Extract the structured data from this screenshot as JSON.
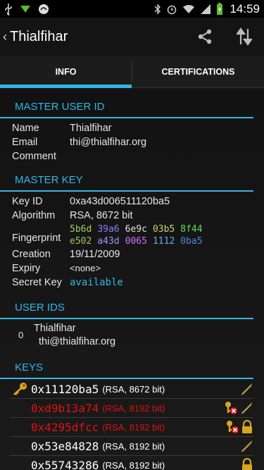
{
  "status_bar": {
    "time": "14:59"
  },
  "action_bar": {
    "back": "‹",
    "title": "Thialfihar"
  },
  "tabs": [
    {
      "label": "INFO"
    },
    {
      "label": "CERTIFICATIONS"
    }
  ],
  "master_user_id": {
    "header": "MASTER USER ID",
    "name_label": "Name",
    "name_value": "Thialfihar",
    "email_label": "Email",
    "email_value": "thi@thialfihar.org",
    "comment_label": "Comment",
    "comment_value": ""
  },
  "master_key": {
    "header": "MASTER KEY",
    "key_id_label": "Key ID",
    "key_id_value": "0xa43d006511120ba5",
    "algorithm_label": "Algorithm",
    "algorithm_value": "RSA, 8672 bit",
    "fingerprint_label": "Fingerprint",
    "fingerprint": [
      [
        {
          "text": "5b6d",
          "color": "#a0d060"
        },
        {
          "text": "39a6",
          "color": "#8a7dff"
        },
        {
          "text": "6e9c",
          "color": "#e0e0e0"
        },
        {
          "text": "03b5",
          "color": "#c8d46a"
        },
        {
          "text": "8f44",
          "color": "#5fdc5f"
        }
      ],
      [
        {
          "text": "e502",
          "color": "#9ac860"
        },
        {
          "text": "a43d",
          "color": "#a88cff"
        },
        {
          "text": "0065",
          "color": "#d86cff"
        },
        {
          "text": "1112",
          "color": "#6aa8f0"
        },
        {
          "text": "0ba5",
          "color": "#4f86e0"
        }
      ]
    ],
    "creation_label": "Creation",
    "creation_value": "19/11/2009",
    "expiry_label": "Expiry",
    "expiry_value": "<none>",
    "secret_key_label": "Secret Key",
    "secret_key_value": "available"
  },
  "user_ids": {
    "header": "USER IDS",
    "items": [
      {
        "rank": "0",
        "name": "Thialfihar",
        "email": "thi@thialfihar.org"
      }
    ]
  },
  "keys": {
    "header": "KEYS",
    "items": [
      {
        "id": "0x11120ba5",
        "algo": "(RSA, 8672 bit)",
        "revoked": false
      },
      {
        "id": "0xd9b13a74",
        "algo": "(RSA, 8192 bit)",
        "revoked": true
      },
      {
        "id": "0x4295dfcc",
        "algo": "(RSA, 8192 bit)",
        "revoked": true
      },
      {
        "id": "0x53e84828",
        "algo": "(RSA, 8192 bit)",
        "revoked": false
      },
      {
        "id": "0x55743286",
        "algo": "(RSA, 8192 bit)",
        "revoked": false
      }
    ]
  },
  "colors": {
    "accent": "#33b5e5",
    "revoked": "#e01010",
    "secret_available": "#33b5e5",
    "key_gold": "#d9a520"
  }
}
